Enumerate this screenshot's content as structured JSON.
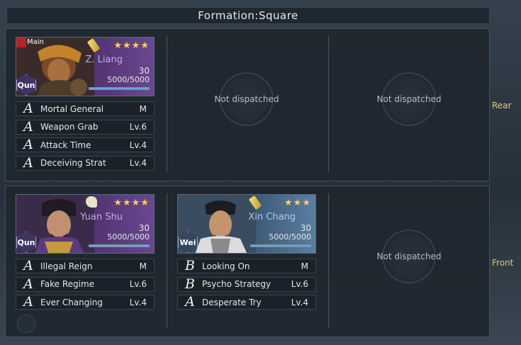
{
  "title": "Formation:Square",
  "rows": {
    "rear": {
      "label": "Rear",
      "slot1": {
        "main_tag": "Main",
        "name": "Z. Liang",
        "stars": "★★★★",
        "level": "30",
        "troops": "5000/5000",
        "troop_fill": 1.0,
        "faction": "Qun",
        "skills": [
          {
            "grade": "A",
            "name": "Mortal General",
            "lv": "M"
          },
          {
            "grade": "A",
            "name": "Weapon Grab",
            "lv": "Lv.6"
          },
          {
            "grade": "A",
            "name": "Attack Time",
            "lv": "Lv.4"
          },
          {
            "grade": "A",
            "name": "Deceiving Strat",
            "lv": "Lv.4"
          }
        ]
      },
      "slot2": {
        "text": "Not dispatched"
      },
      "slot3": {
        "text": "Not dispatched"
      }
    },
    "front": {
      "label": "Front",
      "slot1": {
        "name": "Yuan Shu",
        "stars": "★★★★",
        "level": "30",
        "troops": "5000/5000",
        "troop_fill": 1.0,
        "faction": "Qun",
        "skills": [
          {
            "grade": "A",
            "name": "Illegal Reign",
            "lv": "M"
          },
          {
            "grade": "A",
            "name": "Fake Regime",
            "lv": "Lv.6"
          },
          {
            "grade": "A",
            "name": "Ever Changing",
            "lv": "Lv.4"
          }
        ]
      },
      "slot2": {
        "name": "Xin Chang",
        "stars": "★★★",
        "level": "30",
        "troops": "5000/5000",
        "troop_fill": 1.0,
        "faction": "Wei",
        "skills": [
          {
            "grade": "B",
            "name": "Looking On",
            "lv": "M"
          },
          {
            "grade": "B",
            "name": "Psycho Strategy",
            "lv": "Lv.6"
          },
          {
            "grade": "A",
            "name": "Desperate Try",
            "lv": "Lv.4"
          }
        ]
      },
      "slot3": {
        "text": "Not dispatched"
      }
    }
  },
  "colors": {
    "label_gold": "#e0c882",
    "star_gold": "#f6d060",
    "troop_blue": "#6aa2e0"
  }
}
